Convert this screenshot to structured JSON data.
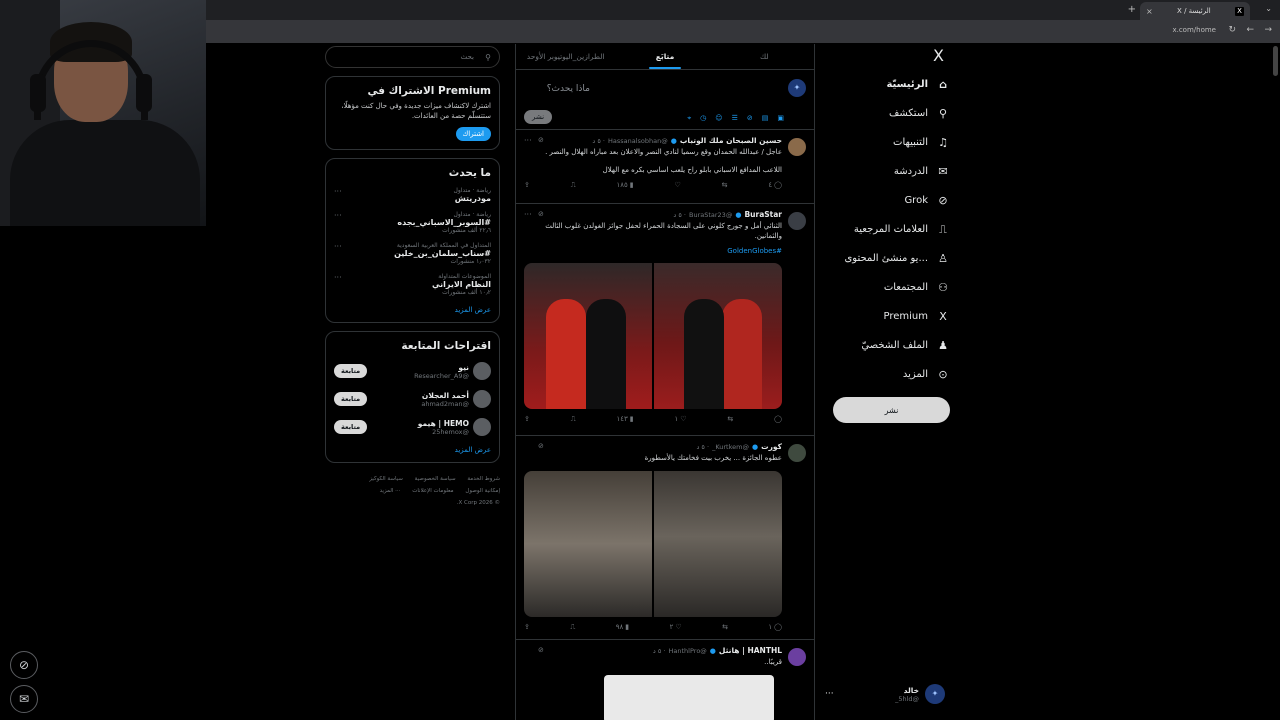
{
  "browser": {
    "tab_title": "الرئيسة / X",
    "url": "x.com/home"
  },
  "search": {
    "placeholder": "بحث"
  },
  "premium": {
    "title": "Premium الاشتراك في",
    "body": "اشترك لاكتشاف ميزات جديدة وفي حال كنت مؤهلًا، ستتسلّم حصة من العائدات.",
    "button": "اشتراك"
  },
  "trends": {
    "title": "ما يحدث",
    "items": [
      {
        "meta": "رياضة · متداول",
        "name": "مودريتش",
        "count": ""
      },
      {
        "meta": "رياضة · متداول",
        "name": "#السوبر_الاسباني_بجده",
        "count": "٢٢٫٦ ألف منشورات"
      },
      {
        "meta": "المتداول في المملكة العربية السعودية",
        "name": "#سناب_سلمان_بن_خلين",
        "count": "١٫٠٣٢ منشورات"
      },
      {
        "meta": "الموضوعات المتداولة",
        "name": "النظام الايراني",
        "count": "١٠٫٢ ألف منشورات"
      }
    ],
    "more": "عرض المزيد"
  },
  "suggestions": {
    "title": "اقتراحات المتابعة",
    "items": [
      {
        "name": "نيو",
        "handle": "@Researcher_A9",
        "button": "متابعة"
      },
      {
        "name": "أحمد العجلان",
        "handle": "@ahmad2man",
        "button": "متابعة"
      },
      {
        "name": "HEMO | هيمو",
        "handle": "@25hemox",
        "button": "متابعة"
      }
    ],
    "more": "عرض المزيد"
  },
  "footer": {
    "links": [
      "شروط الخدمة",
      "سياسة الخصوصية",
      "سياسة الكوكيز",
      "إمكانية الوصول",
      "معلومات الإعلانات",
      "··· المزيد"
    ],
    "copyright": "© 2026 X Corp."
  },
  "timeline": {
    "tabs": [
      "لك",
      "متابَع",
      "الطرازين_اليوتيوبر الأوحد"
    ],
    "compose_placeholder": "ماذا يحدث؟",
    "post_button": "نشر",
    "posts": [
      {
        "name": "حسين الصبحان ملك الوتباب",
        "handle": "@Hassanalsobhan",
        "time": "· ٥ د",
        "text": "عاجل / عبدالله الحمدان وقع رسميا لنادي النصر والاعلان  بعد مباراه الهلال والنصر .",
        "text2": "اللاعب المدافع الاسباني بابلو راح يلعب اساسي بكره مع الهلال",
        "stats": {
          "reply": "٤",
          "retweet": "",
          "like": "",
          "views": "١٨٥"
        }
      },
      {
        "name": "BuraStar",
        "handle": "@BuraStar23",
        "time": "· ٥ د",
        "text": "الثنائي أمل و جورج كلوني على السجادة الحمراء لحفل جوائز الغولدن غلوب الثالث والثمانين.",
        "hashtag": "#GoldenGlobes",
        "stats": {
          "reply": "",
          "retweet": "",
          "like": "١",
          "views": "١٤٣"
        }
      },
      {
        "name": "كورت",
        "handle": "@Kurtkem_",
        "time": "· ٥ د",
        "text": "عطوه الجائزة ... يخرب بيت فخامتك يالأسطورة",
        "stats": {
          "reply": "١",
          "retweet": "",
          "like": "٢",
          "views": "٩٨"
        }
      },
      {
        "name": "HANTHL | هانثل",
        "handle": "@HanthlPro",
        "time": "· ٥ د",
        "text": "قريبًا.."
      }
    ]
  },
  "nav": {
    "items": [
      {
        "label": "الرئيسيّة",
        "icon": "home-icon",
        "glyph": "⌂"
      },
      {
        "label": "استكشف",
        "icon": "search-icon",
        "glyph": "⚲"
      },
      {
        "label": "التنبيهات",
        "icon": "bell-icon",
        "glyph": "♫"
      },
      {
        "label": "الدردشة",
        "icon": "mail-icon",
        "glyph": "✉"
      },
      {
        "label": "Grok",
        "icon": "grok-icon",
        "glyph": "⊘"
      },
      {
        "label": "العلامات المرجعية",
        "icon": "bookmark-icon",
        "glyph": "⎍"
      },
      {
        "label": "...يو منشئ المحتوى",
        "icon": "creator-icon",
        "glyph": "♙"
      },
      {
        "label": "المجتمعات",
        "icon": "communities-icon",
        "glyph": "⚇"
      },
      {
        "label": "Premium",
        "icon": "x-logo-icon",
        "glyph": "X"
      },
      {
        "label": "الملف الشخصيّ",
        "icon": "profile-icon",
        "glyph": "♟"
      },
      {
        "label": "المزيد",
        "icon": "more-icon",
        "glyph": "⊙"
      }
    ],
    "post_button": "نشر"
  },
  "profile": {
    "name": "خالد",
    "handle": "@5hld_"
  },
  "colors": {
    "accent": "#1d9bf0",
    "bg": "#000000",
    "border": "#2f3336"
  }
}
